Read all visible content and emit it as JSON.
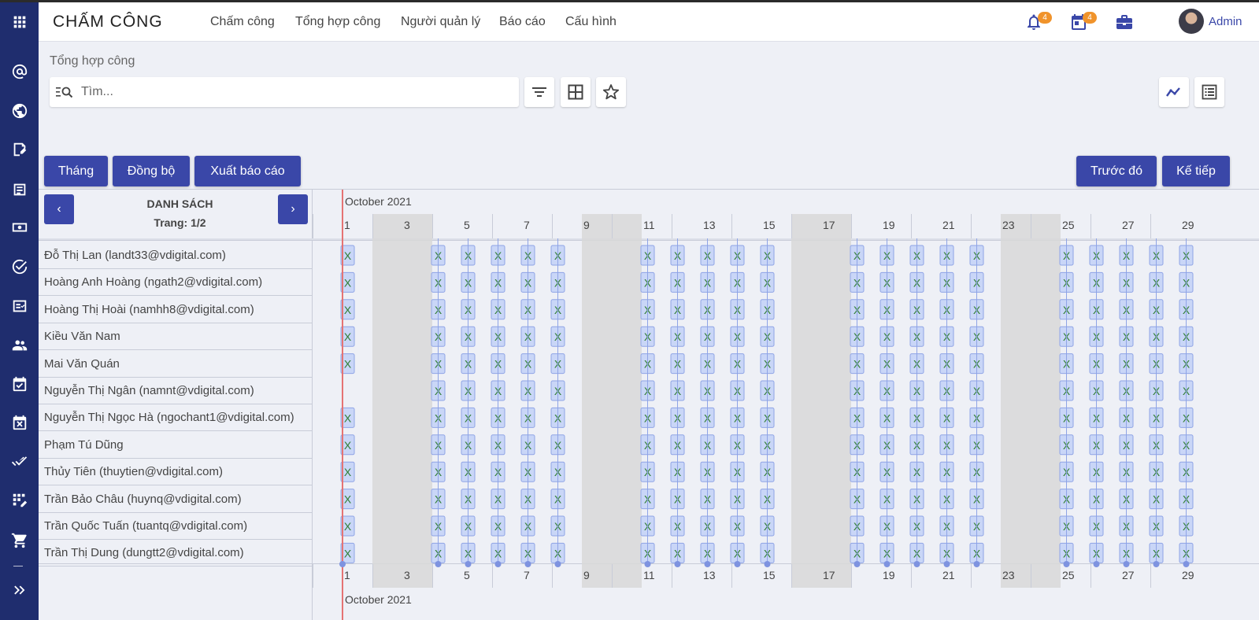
{
  "app": {
    "title": "CHẤM CÔNG"
  },
  "nav": [
    {
      "label": "Chấm công"
    },
    {
      "label": "Tổng hợp công"
    },
    {
      "label": "Người quản lý"
    },
    {
      "label": "Báo cáo"
    },
    {
      "label": "Cấu hình"
    }
  ],
  "header": {
    "notification_count": "4",
    "calendar_count": "4",
    "user_name": "Admin"
  },
  "sidebar": {
    "icons": [
      "apps-icon",
      "at-sign-icon",
      "globe-icon",
      "contract-icon",
      "document-icon",
      "money-icon",
      "check-circle-icon",
      "checklist-icon",
      "users-icon",
      "calendar-check-icon",
      "calendar-x-icon",
      "double-check-icon",
      "grid-edit-icon",
      "cart-icon",
      "expand-icon"
    ]
  },
  "breadcrumb": "Tổng hợp công",
  "search": {
    "placeholder": "Tìm..."
  },
  "toolbar": {
    "month_label": "Tháng",
    "sync_label": "Đồng bộ",
    "export_label": "Xuất báo cáo",
    "prev_label": "Trước đó",
    "next_label": "Kế tiếp"
  },
  "list": {
    "title": "DANH SÁCH",
    "page": "Trang: 1/2",
    "prev_arrow": "‹",
    "next_arrow": "›"
  },
  "colors": {
    "primary": "#3a47a8",
    "sidebar": "#1f2d6e",
    "weekend": "#d8d8d8",
    "today_line": "#e57373",
    "mark_fill": "#c9d6f7",
    "mark_text": "#2e7d32"
  },
  "chart_data": {
    "type": "gantt",
    "month_label": "October 2021",
    "days": 29,
    "day_labels": [
      "1",
      "3",
      "5",
      "7",
      "9",
      "11",
      "13",
      "15",
      "17",
      "19",
      "21",
      "23",
      "25",
      "27",
      "29"
    ],
    "weekend_days": [
      2,
      3,
      9,
      10,
      16,
      17,
      23,
      24
    ],
    "today": 1,
    "mark_text": "X",
    "employees": [
      {
        "name": "Đỗ Thị Lan (landt33@vdigital.com)",
        "days": [
          1,
          4,
          5,
          6,
          7,
          8,
          11,
          12,
          13,
          14,
          15,
          18,
          19,
          20,
          21,
          22,
          25,
          26,
          27,
          28,
          29
        ]
      },
      {
        "name": "Hoàng Anh Hoàng (ngath2@vdigital.com)",
        "days": [
          1,
          4,
          5,
          6,
          7,
          8,
          11,
          12,
          13,
          14,
          15,
          18,
          19,
          20,
          21,
          22,
          25,
          26,
          27,
          28,
          29
        ]
      },
      {
        "name": "Hoàng Thị Hoài (namhh8@vdigital.com)",
        "days": [
          1,
          4,
          5,
          6,
          7,
          8,
          11,
          12,
          13,
          14,
          15,
          18,
          19,
          20,
          21,
          22,
          25,
          26,
          27,
          28,
          29
        ]
      },
      {
        "name": "Kiều Văn Nam",
        "days": [
          1,
          4,
          5,
          6,
          7,
          8,
          11,
          12,
          13,
          14,
          15,
          18,
          19,
          20,
          21,
          22,
          25,
          26,
          27,
          28,
          29
        ]
      },
      {
        "name": "Mai Văn Quán",
        "days": [
          1,
          4,
          5,
          6,
          7,
          8,
          11,
          12,
          13,
          14,
          15,
          18,
          19,
          20,
          21,
          22,
          25,
          26,
          27,
          28,
          29
        ]
      },
      {
        "name": "Nguyễn Thị Ngân (namnt@vdigital.com)",
        "days": [
          4,
          5,
          6,
          7,
          8,
          11,
          12,
          13,
          14,
          15,
          18,
          19,
          20,
          21,
          22,
          25,
          26,
          27,
          28,
          29
        ]
      },
      {
        "name": "Nguyễn Thị Ngọc Hà (ngochant1@vdigital.com)",
        "days": [
          1,
          4,
          5,
          6,
          7,
          8,
          11,
          12,
          13,
          14,
          15,
          18,
          19,
          20,
          21,
          22,
          25,
          26,
          27,
          28,
          29
        ]
      },
      {
        "name": "Phạm Tú Dũng",
        "days": [
          1,
          4,
          5,
          6,
          7,
          8,
          11,
          12,
          13,
          14,
          15,
          18,
          19,
          20,
          21,
          22,
          25,
          26,
          27,
          28,
          29
        ]
      },
      {
        "name": "Thủy Tiên (thuytien@vdigital.com)",
        "days": [
          1,
          4,
          5,
          6,
          7,
          8,
          11,
          12,
          13,
          14,
          15,
          18,
          19,
          20,
          21,
          22,
          25,
          26,
          27,
          28,
          29
        ]
      },
      {
        "name": "Trần Bảo Châu (huynq@vdigital.com)",
        "days": [
          1,
          4,
          5,
          6,
          7,
          8,
          11,
          12,
          13,
          14,
          15,
          18,
          19,
          20,
          21,
          22,
          25,
          26,
          27,
          28,
          29
        ]
      },
      {
        "name": "Trần Quốc Tuấn (tuantq@vdigital.com)",
        "days": [
          1,
          4,
          5,
          6,
          7,
          8,
          11,
          12,
          13,
          14,
          15,
          18,
          19,
          20,
          21,
          22,
          25,
          26,
          27,
          28,
          29
        ]
      },
      {
        "name": "Trần Thị Dung (dungtt2@vdigital.com)",
        "days": [
          1,
          4,
          5,
          6,
          7,
          8,
          11,
          12,
          13,
          14,
          15,
          18,
          19,
          20,
          21,
          22,
          25,
          26,
          27,
          28,
          29
        ]
      }
    ]
  }
}
